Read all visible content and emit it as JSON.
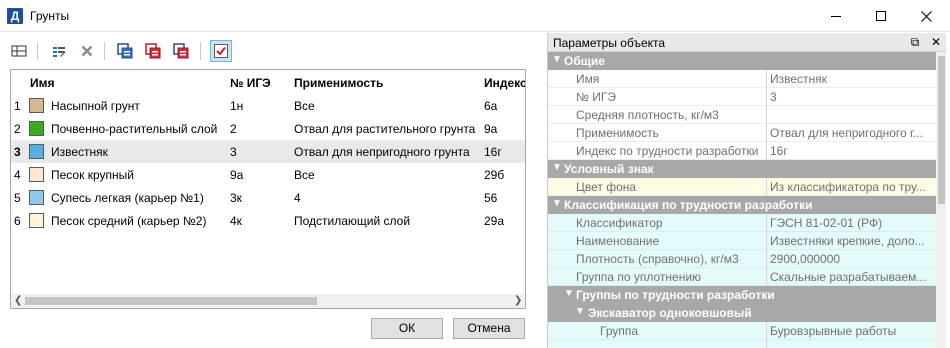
{
  "window": {
    "icon_letter": "Д",
    "title": "Грунты"
  },
  "grid": {
    "columns": [
      "Имя",
      "№ ИГЭ",
      "Применимость",
      "Индекс"
    ],
    "rows": [
      {
        "num": "1",
        "color": "#d4b896",
        "name": "Насыпной грунт",
        "ige": "1н",
        "applicability": "Все",
        "index": "6а"
      },
      {
        "num": "2",
        "color": "#3aaa1e",
        "name": "Почвенно-растительный слой",
        "ige": "2",
        "applicability": "Отвал для растительного грунта",
        "index": "9а"
      },
      {
        "num": "3",
        "color": "#5aaee0",
        "name": "Известняк",
        "ige": "3",
        "applicability": "Отвал для непригодного грунта",
        "index": "16г"
      },
      {
        "num": "4",
        "color": "#fde9cf",
        "name": "Песок крупный",
        "ige": "9а",
        "applicability": "Все",
        "index": "29б"
      },
      {
        "num": "5",
        "color": "#8fc8e8",
        "name": "Супесь легкая (карьер №1)",
        "ige": "3к",
        "applicability": "4",
        "index": "56"
      },
      {
        "num": "6",
        "color": "#fff3da",
        "name": "Песок средний (карьер №2)",
        "ige": "4к",
        "applicability": "Подстилающий слой",
        "index": "29а"
      }
    ],
    "selected_row": 3
  },
  "buttons": {
    "ok": "ОК",
    "cancel": "Отмена"
  },
  "props": {
    "title": "Параметры объекта",
    "general": {
      "label": "Общие",
      "rows": [
        {
          "label": "Имя",
          "value": "Известняк"
        },
        {
          "label": "№ ИГЭ",
          "value": "3"
        },
        {
          "label": "Средняя плотность, кг/м3",
          "value": ""
        },
        {
          "label": "Применимость",
          "value": "Отвал для непригодного г..."
        },
        {
          "label": "Индекс по трудности разработки",
          "value": "16г"
        }
      ]
    },
    "symbol": {
      "label": "Условный знак",
      "rows": [
        {
          "label": "Цвет фона",
          "value": "Из классификатора по тру..."
        }
      ]
    },
    "classification": {
      "label": "Классификация по трудности разработки",
      "rows": [
        {
          "label": "Классификатор",
          "value": "ГЭСН 81-02-01 (РФ)"
        },
        {
          "label": "Наименование",
          "value": "Известняки крепкие, доло..."
        },
        {
          "label": "Плотность (справочно), кг/м3",
          "value": "2900,000000"
        },
        {
          "label": "Группа по уплотнению",
          "value": "Скальные разрабатываем..."
        }
      ]
    },
    "groups": {
      "label": "Группы по трудности разработки"
    },
    "excavator": {
      "label": "Экскаватор одноковшовый",
      "rows": [
        {
          "label": "Группа",
          "value": "Буровзрывные работы"
        }
      ]
    }
  },
  "colors": {
    "category_bg": "#a8a8a8",
    "cyan_row": "#e5fbfb",
    "yellow_row": "#fffbe4",
    "selected_row": "#e9e9e9"
  }
}
